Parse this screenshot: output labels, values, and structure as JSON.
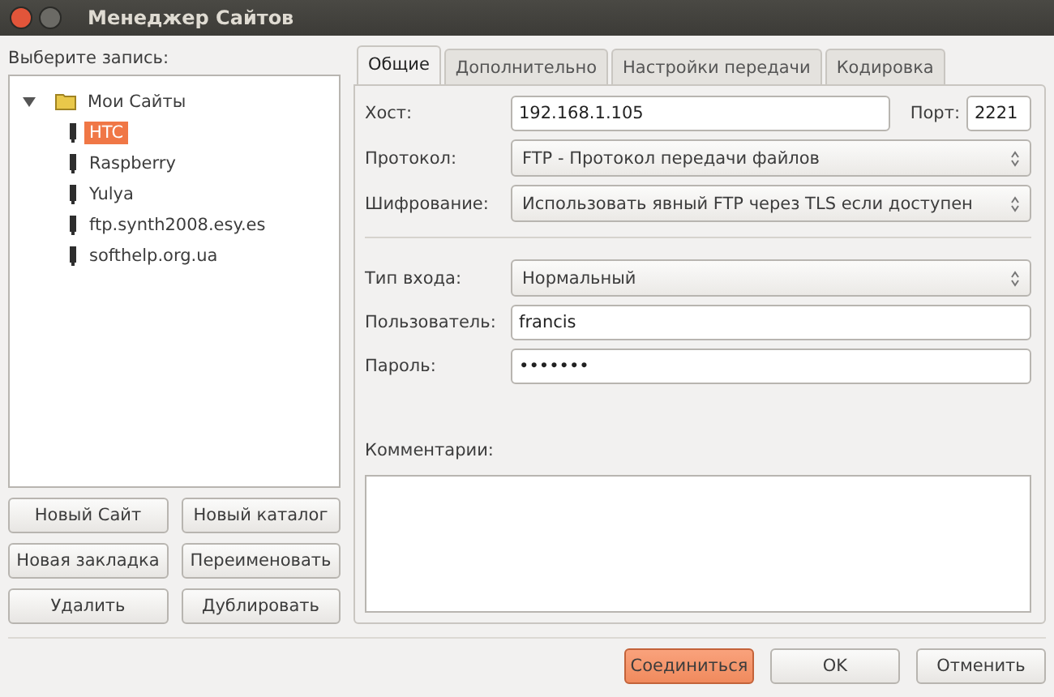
{
  "window": {
    "title": "Менеджер Сайтов"
  },
  "tree_label": "Выберите запись:",
  "tree": [
    {
      "label": "Мои Сайты",
      "expanded": true,
      "children": [
        {
          "label": "HTC",
          "selected": true
        },
        {
          "label": "Raspberry",
          "selected": false
        },
        {
          "label": "Yulya",
          "selected": false
        },
        {
          "label": "ftp.synth2008.esy.es",
          "selected": false
        },
        {
          "label": "softhelp.org.ua",
          "selected": false
        }
      ]
    }
  ],
  "tree_buttons": [
    "Новый Сайт",
    "Новый каталог",
    "Новая закладка",
    "Переименовать",
    "Удалить",
    "Дублировать"
  ],
  "tabs": [
    {
      "label": "Общие",
      "selected": true
    },
    {
      "label": "Дополнительно",
      "selected": false
    },
    {
      "label": "Настройки передачи",
      "selected": false
    },
    {
      "label": "Кодировка",
      "selected": false
    }
  ],
  "host": {
    "label": "Хост:",
    "value": "192.168.1.105"
  },
  "port": {
    "label": "Порт:",
    "value": "2221"
  },
  "protocol": {
    "label": "Протокол:",
    "value": "FTP - Протокол передачи файлов"
  },
  "encryption": {
    "label": "Шифрование:",
    "value": "Использовать явный FTP через TLS если доступен"
  },
  "logon_type": {
    "label": "Тип входа:",
    "value": "Нормальный"
  },
  "user": {
    "label": "Пользователь:",
    "value": "francis"
  },
  "password": {
    "label": "Пароль:",
    "value": "•••••••"
  },
  "comments": {
    "label": "Комментарии:"
  },
  "dialog_buttons": [
    {
      "label": "Соединиться",
      "kind": "primary"
    },
    {
      "label": "OK",
      "kind": "normal"
    },
    {
      "label": "Отменить",
      "kind": "normal"
    }
  ]
}
